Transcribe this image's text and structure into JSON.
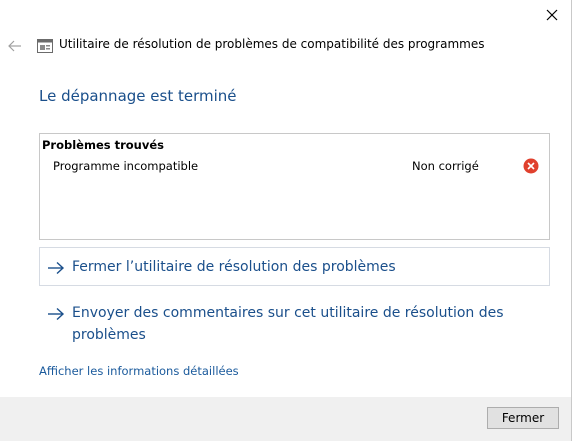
{
  "window": {
    "title": "Utilitaire de résolution de problèmes de compatibilité des programmes"
  },
  "heading": "Le dépannage est terminé",
  "results": {
    "title": "Problèmes trouvés",
    "problems": [
      {
        "name": "Programme incompatible",
        "status": "Non corrigé",
        "status_icon": "error-icon"
      }
    ]
  },
  "options": {
    "close_label": "Fermer l’utilitaire de résolution des problèmes",
    "feedback_label": "Envoyer des commentaires sur cet utilitaire de résolution des problèmes"
  },
  "details_link": "Afficher les informations détaillées",
  "footer": {
    "close_button": "Fermer"
  },
  "colors": {
    "accent": "#1a4f8b",
    "error": "#e0402d"
  }
}
